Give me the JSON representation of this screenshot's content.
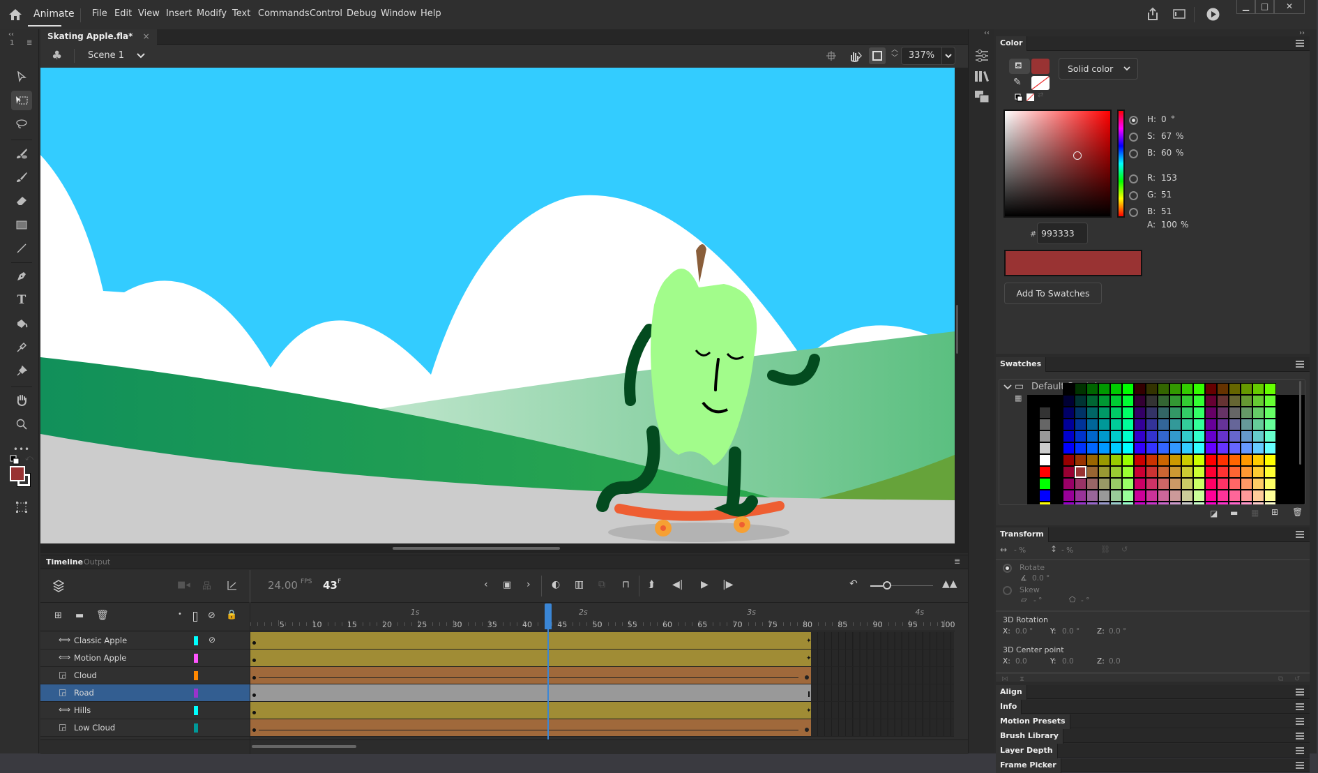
{
  "app": {
    "brand": "Animate",
    "menu": [
      "File",
      "Edit",
      "View",
      "Insert",
      "Modify",
      "Text",
      "Commands",
      "Control",
      "Debug",
      "Window",
      "Help"
    ],
    "window_controls": [
      "minimize",
      "maximize",
      "close"
    ]
  },
  "document": {
    "tab_title": "Skating Apple.fla*",
    "scene": "Scene 1",
    "zoom": "337%"
  },
  "toolbar": {
    "tools": [
      "selection",
      "free-transform",
      "lasso",
      "paint-brush",
      "brush",
      "eraser",
      "rectangle",
      "line",
      "pen",
      "text",
      "paint-bucket",
      "eyedropper",
      "asset-warp",
      "hand",
      "zoom",
      "more"
    ],
    "fill_color": "#993333"
  },
  "timeline": {
    "tabs": [
      "Timeline",
      "Output"
    ],
    "fps": "24.00",
    "fps_unit": "FPS",
    "current_frame": "43",
    "frame_unit": "F",
    "ruler_numbers": [
      5,
      10,
      15,
      20,
      25,
      30,
      35,
      40,
      45,
      50,
      55,
      60,
      65,
      70,
      75,
      80,
      85,
      90,
      95,
      100
    ],
    "seconds_markers": [
      "1s",
      "2s",
      "3s",
      "4s"
    ],
    "layers": [
      {
        "name": "Classic Apple",
        "type": "symbol",
        "color": "#00ffff",
        "hidden": true,
        "frames_color": "#a08c35"
      },
      {
        "name": "Motion Apple",
        "type": "symbol",
        "color": "#ff55ff",
        "hidden": false,
        "frames_color": "#a08c35"
      },
      {
        "name": "Cloud",
        "type": "layer",
        "color": "#ff8800",
        "hidden": false,
        "frames_color": "#a0693b"
      },
      {
        "name": "Road",
        "type": "layer",
        "color": "#9933cc",
        "hidden": false,
        "frames_color": "#999999",
        "selected": true
      },
      {
        "name": "Hills",
        "type": "symbol",
        "color": "#00ffff",
        "hidden": false,
        "frames_color": "#a08c35"
      },
      {
        "name": "Low Cloud",
        "type": "layer",
        "color": "#009999",
        "hidden": false,
        "frames_color": "#a0693b"
      }
    ],
    "last_frame": 80,
    "playhead_frame": 43
  },
  "color_panel": {
    "title": "Color",
    "fill_type": "Solid color",
    "hsb": {
      "H": "0",
      "S": "67",
      "B": "60"
    },
    "rgb": {
      "R": "153",
      "G": "51",
      "B": "51"
    },
    "alpha": "100",
    "hex": "993333",
    "labels": {
      "H": "H:",
      "S": "S:",
      "B": "B:",
      "R": "R:",
      "G": "G:",
      "Bl": "B:",
      "A": "A:",
      "hash": "#",
      "deg": "°",
      "pct": "%"
    },
    "add_button": "Add To Swatches",
    "swatch_color": "#993333"
  },
  "swatches_panel": {
    "title": "Swatches",
    "folder": "Default Swatches"
  },
  "transform_panel": {
    "title": "Transform",
    "width_pct": "- %",
    "height_pct": "- %",
    "rotate_label": "Rotate",
    "rotate_value": "0.0 °",
    "skew_label": "Skew",
    "skew_h": "- °",
    "skew_v": "- °",
    "rot3d_label": "3D Rotation",
    "rot3d": {
      "X": "0.0 °",
      "Y": "0.0 °",
      "Z": "0.0 °"
    },
    "center_label": "3D Center point",
    "center": {
      "X": "0.0",
      "Y": "0.0",
      "Z": "0.0"
    },
    "axis_labels": {
      "X": "X:",
      "Y": "Y:",
      "Z": "Z:"
    }
  },
  "collapsed_panels": [
    "Align",
    "Info",
    "Motion Presets",
    "Brush Library",
    "Layer Depth",
    "Frame Picker"
  ]
}
